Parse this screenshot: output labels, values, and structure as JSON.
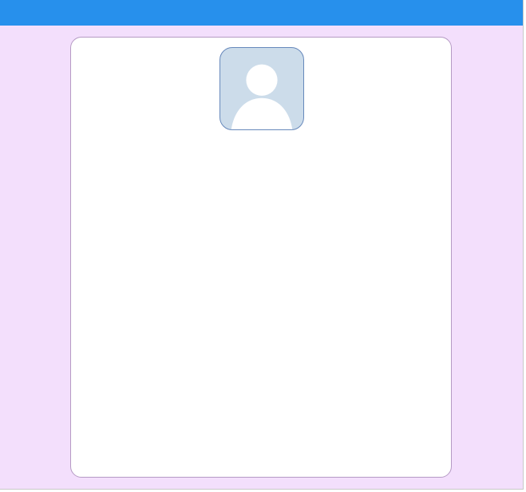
{
  "colors": {
    "header": "#2790ec",
    "background": "#f3dffc",
    "card": "#ffffff",
    "card_border": "#b59ac4",
    "avatar_background": "#ccdcea",
    "avatar_border": "#6688bb",
    "avatar_figure": "#ffffff"
  },
  "avatar": {
    "icon": "default-user-silhouette-icon"
  }
}
